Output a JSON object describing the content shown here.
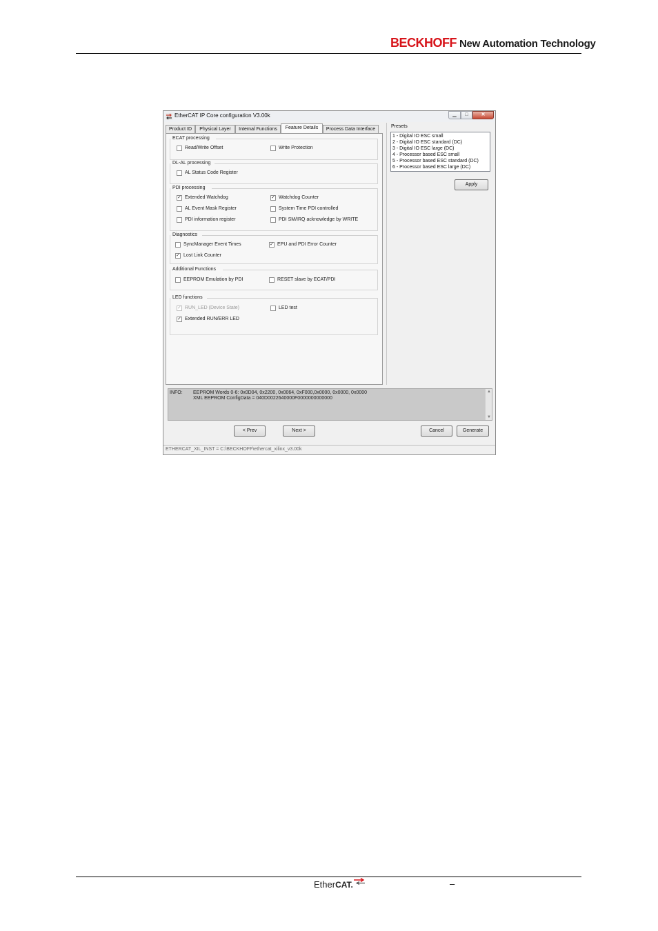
{
  "page": {
    "brand_name": "BECKHOFF",
    "brand_slogan": "New Automation Technology",
    "footer_logo_ether": "Ether",
    "footer_logo_cat": "CAT.",
    "footer_dash": "–"
  },
  "window": {
    "title": "EtherCAT IP Core configuration V3.00k",
    "minimize_glyph": "▁",
    "maximize_glyph": "□",
    "close_glyph": "✕"
  },
  "tabs": [
    {
      "label": "Product ID",
      "active": false
    },
    {
      "label": "Physical Layer",
      "active": false
    },
    {
      "label": "Internal Functions",
      "active": false
    },
    {
      "label": "Feature Details",
      "active": true
    },
    {
      "label": "Process Data Interface",
      "active": false
    }
  ],
  "groups": {
    "ecat_processing": "ECAT processing",
    "dl_al_processing": "DL-AL processing",
    "pdi_processing": "PDI processing",
    "diagnostics": "Diagnostics",
    "additional_functions": "Additional Functions",
    "led_functions": "LED functions"
  },
  "options": {
    "read_write_offset": {
      "label": "Read/Write Offset",
      "checked": false
    },
    "write_protection": {
      "label": "Write Protection",
      "checked": false
    },
    "al_status_code_register": {
      "label": "AL Status Code Register",
      "checked": false
    },
    "extended_watchdog": {
      "label": "Extended Watchdog",
      "checked": true
    },
    "watchdog_counter": {
      "label": "Watchdog Counter",
      "checked": true
    },
    "al_event_mask_register": {
      "label": "AL Event Mask Register",
      "checked": false
    },
    "system_time_pdi_controlled": {
      "label": "System Time PDI controlled",
      "checked": false
    },
    "pdi_information_register": {
      "label": "PDI information register",
      "checked": false
    },
    "pdi_sm_irq_ack_by_write": {
      "label": "PDI SM/IRQ acknowledge by WRITE",
      "checked": false
    },
    "syncmanager_event_times": {
      "label": "SyncManager Event Times",
      "checked": false
    },
    "epu_pdi_error_counter": {
      "label": "EPU and PDI Error Counter",
      "checked": true
    },
    "lost_link_counter": {
      "label": "Lost Link Counter",
      "checked": true
    },
    "eeprom_emulation_by_pdi": {
      "label": "EEPROM Emulation by PDI",
      "checked": false
    },
    "reset_slave_by_ecat_pdi": {
      "label": "RESET slave by ECAT/PDI",
      "checked": false
    },
    "run_led_device_state": {
      "label": "RUN_LED (Device State)",
      "checked": true,
      "disabled": true
    },
    "led_test": {
      "label": "LED test",
      "checked": false
    },
    "extended_run_err_led": {
      "label": "Extended RUN/ERR LED",
      "checked": true
    }
  },
  "presets": {
    "title": "Presets",
    "items": [
      "1 - Digital IO ESC small",
      "2 - Digital IO ESC standard (DC)",
      "3 - Digital IO ESC large (DC)",
      "4 - Processor based ESC small",
      "5 - Processor based ESC standard (DC)",
      "6 - Processor based ESC large (DC)"
    ],
    "apply_label": "Apply"
  },
  "info": {
    "label": "INFO:",
    "line1": "EEPROM Words 0-6: 0x0D04, 0x2200, 0x0064, 0xF000,0x0000, 0x0000, 0x0000",
    "line2": "XML EEPROM ConfigData = 040D0022640000F0000000000000",
    "scroll_up": "▲",
    "scroll_down": "▼"
  },
  "buttons": {
    "prev": "< Prev",
    "next": "Next >",
    "cancel": "Cancel",
    "generate": "Generate"
  },
  "status_bar": "ETHERCAT_XIL_INST =  C:\\BECKHOFF\\ethercat_xilinx_v3.00k",
  "colors": {
    "brand_red": "#d7141a",
    "window_bg": "#f0f0f0",
    "info_bg": "#c9c9c9"
  }
}
